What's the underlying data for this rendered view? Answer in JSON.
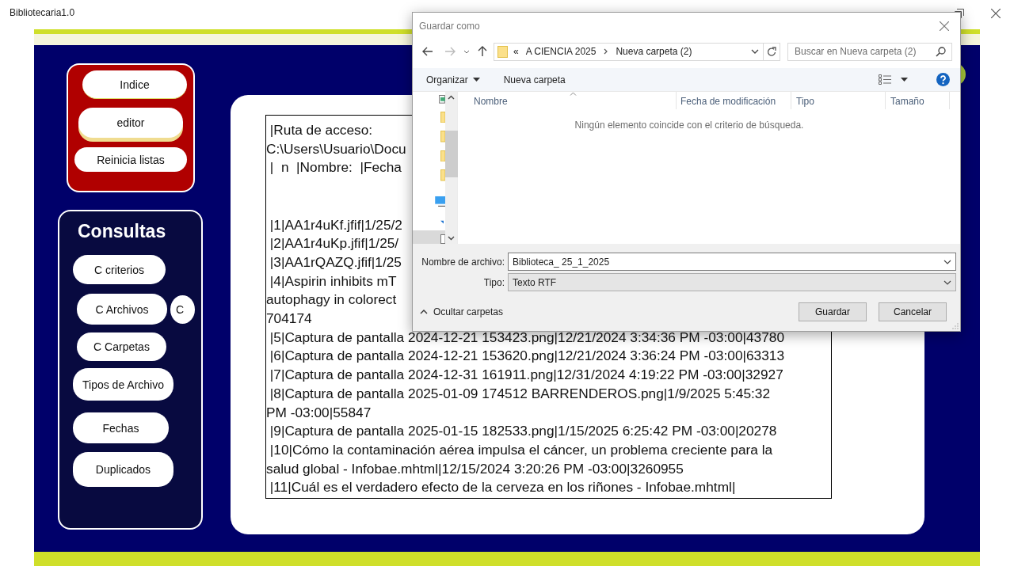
{
  "window": {
    "title": "Bibliotecaria1.0"
  },
  "menu_panel": {
    "buttons": [
      {
        "label": "Indice",
        "focused": false
      },
      {
        "label": "editor",
        "focused": true
      },
      {
        "label": "Reinicia listas",
        "focused": false
      }
    ]
  },
  "consultas": {
    "title": "Consultas",
    "buttons": [
      {
        "label": "C criterios",
        "kind": "pill"
      },
      {
        "label": "C Archivos",
        "kind": "pill"
      },
      {
        "label": "C",
        "kind": "circle"
      },
      {
        "label": "C Carpetas",
        "kind": "pill"
      },
      {
        "label": "Tipos de Archivo",
        "kind": "pill"
      },
      {
        "label": "Fechas",
        "kind": "pill"
      },
      {
        "label": "Duplicados",
        "kind": "pill"
      }
    ]
  },
  "document": {
    "header_lines": [
      " |Ruta de acceso:",
      "C:\\Users\\Usuario\\Docu",
      " |  n  |Nombre:  |Fecha"
    ],
    "entry_lines": [
      " |1|AA1r4uKf.jfif|1/25/2",
      " |2|AA1r4uKp.jfif|1/25/",
      " |3|AA1rQAZQ.jfif|1/25",
      " |4|Aspirin inhibits mT",
      "autophagy in colorect",
      "704174",
      " |5|Captura de pantalla 2024-12-21 153423.png|12/21/2024 3:34:36 PM -03:00|43780",
      " |6|Captura de pantalla 2024-12-21 153620.png|12/21/2024 3:36:24 PM -03:00|63313",
      " |7|Captura de pantalla 2024-12-31 161911.png|12/31/2024 4:19:22 PM -03:00|32927",
      " |8|Captura de pantalla 2025-01-09 174512 BARRENDEROS.png|1/9/2025 5:45:32",
      "PM -03:00|55847",
      " |9|Captura de pantalla 2025-01-15 182533.png|1/15/2025 6:25:42 PM -03:00|20278",
      " |10|Cómo la contaminación aérea impulsa el cáncer, un problema creciente para la",
      "salud global - Infobae.mhtml|12/15/2024 3:20:26 PM -03:00|3260955",
      " |11|Cuál es el verdadero efecto de la cerveza en los riñones - Infobae.mhtml|"
    ]
  },
  "dialog": {
    "title": "Guardar como",
    "overflow_mark": "«",
    "path": [
      "A CIENCIA 2025",
      "Nueva carpeta (2)"
    ],
    "search": {
      "placeholder": "Buscar en Nueva carpeta (2)"
    },
    "toolbar": [
      {
        "label": "Organizar",
        "kind": "menu"
      },
      {
        "label": "Nueva carpeta",
        "kind": "button"
      }
    ],
    "columns": [
      "Nombre",
      "Fecha de modificación",
      "Tipo",
      "Tamaño"
    ],
    "empty_message": "Ningún elemento coincide con el criterio de búsqueda.",
    "fields": [
      {
        "label": "Nombre de archivo:",
        "value": "Biblioteca_ 25_1_2025",
        "kind": "input"
      },
      {
        "label": "Tipo:",
        "value": "Texto RTF",
        "kind": "select"
      }
    ],
    "hide_folders": "Ocultar carpetas",
    "buttons": [
      "Guardar",
      "Cancelar"
    ]
  }
}
